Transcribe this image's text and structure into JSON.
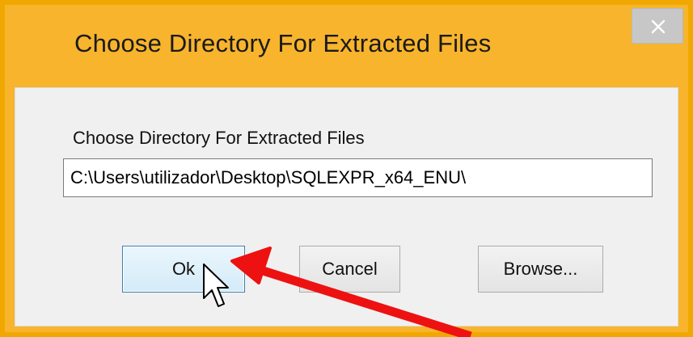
{
  "window": {
    "title": "Choose Directory For Extracted Files",
    "close_label": "✕"
  },
  "dialog": {
    "field_label": "Choose Directory For Extracted Files",
    "path_value": "C:\\Users\\utilizador\\Desktop\\SQLEXPR_x64_ENU\\"
  },
  "buttons": {
    "ok_label": "Ok",
    "cancel_label": "Cancel",
    "browse_label": "Browse..."
  },
  "colors": {
    "titlebar": "#f7b42c",
    "window_border": "#f0a800",
    "client_background": "#f0f0f0",
    "close_button": "#c7c7c7",
    "highlight_arrow": "#ee1111"
  },
  "icons": {
    "close": "close-icon",
    "cursor": "mouse-pointer-icon",
    "annotation": "red-arrow-icon"
  }
}
